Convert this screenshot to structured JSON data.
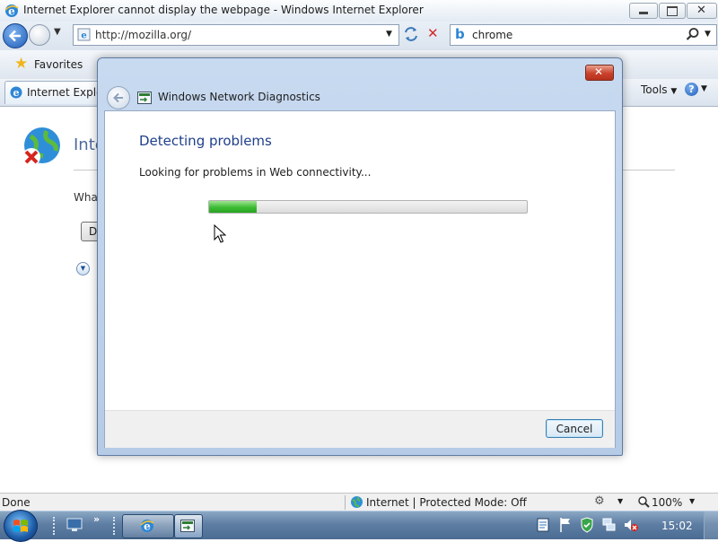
{
  "window": {
    "title": "Internet Explorer cannot display the webpage - Windows Internet Explorer"
  },
  "addressbar": {
    "url": "http://mozilla.org/"
  },
  "search": {
    "value": "chrome"
  },
  "commandbar": {
    "favorites_label": "Favorites",
    "tools_label": "Tools"
  },
  "tab": {
    "title": "Internet Explorer"
  },
  "page": {
    "heading_partial": "Inte",
    "question_partial": "Wha",
    "button_partial": "D"
  },
  "dialog": {
    "title": "Windows Network Diagnostics",
    "heading": "Detecting problems",
    "status": "Looking for problems in Web connectivity...",
    "progress_fraction": 0.15,
    "cancel_label": "Cancel"
  },
  "statusbar": {
    "status": "Done",
    "zone": "Internet | Protected Mode: Off",
    "zoom": "100%"
  },
  "taskbar": {
    "clock": "15:02"
  },
  "colors": {
    "heading_blue": "#1e3f8a",
    "progress_green": "#3dbb35",
    "close_red": "#c9412b"
  }
}
